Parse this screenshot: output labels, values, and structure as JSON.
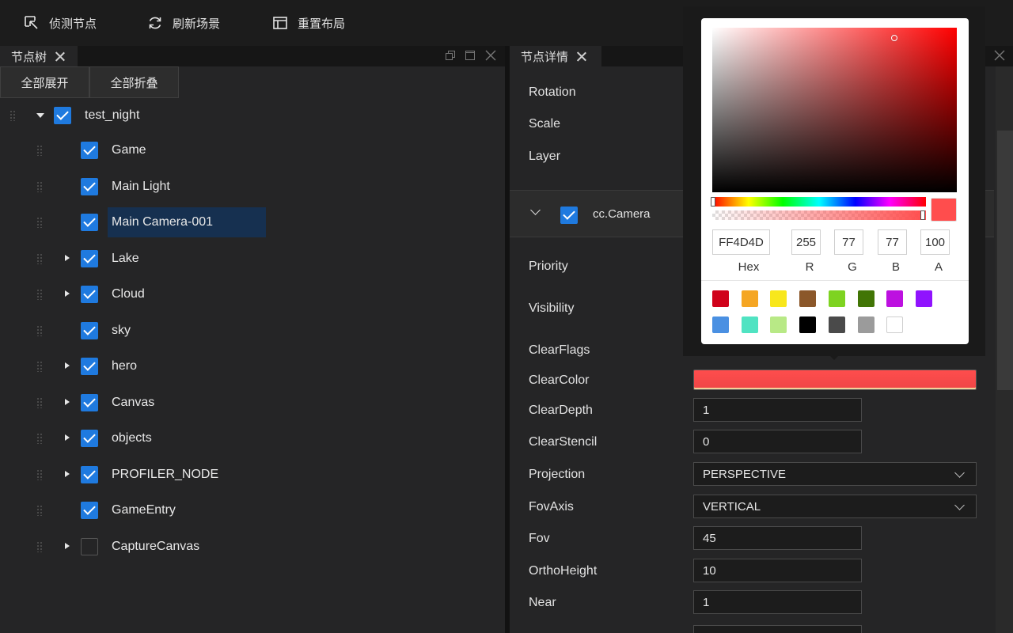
{
  "toolbar": {
    "detect_label": "侦测节点",
    "refresh_label": "刷新场景",
    "reset_label": "重置布局"
  },
  "left_panel": {
    "tab_title": "节点树",
    "expand_all": "全部展开",
    "collapse_all": "全部折叠",
    "tree": [
      {
        "label": "test_night",
        "checked": true,
        "expand": "open"
      },
      {
        "label": "Game",
        "checked": true,
        "expand": "none"
      },
      {
        "label": "Main Light",
        "checked": true,
        "expand": "none"
      },
      {
        "label": "Main Camera-001",
        "checked": true,
        "expand": "none",
        "selected": true
      },
      {
        "label": "Lake",
        "checked": true,
        "expand": "closed"
      },
      {
        "label": "Cloud",
        "checked": true,
        "expand": "closed"
      },
      {
        "label": "sky",
        "checked": true,
        "expand": "none"
      },
      {
        "label": "hero",
        "checked": true,
        "expand": "closed"
      },
      {
        "label": "Canvas",
        "checked": true,
        "expand": "closed"
      },
      {
        "label": "objects",
        "checked": true,
        "expand": "closed"
      },
      {
        "label": "PROFILER_NODE",
        "checked": true,
        "expand": "closed"
      },
      {
        "label": "GameEntry",
        "checked": true,
        "expand": "none"
      },
      {
        "label": "CaptureCanvas",
        "checked": false,
        "expand": "closed"
      }
    ]
  },
  "right_panel": {
    "tab_title": "节点详情",
    "node_props": {
      "rotation": "Rotation",
      "scale": "Scale",
      "layer": "Layer"
    },
    "component": {
      "name": "cc.Camera",
      "enabled": true
    },
    "props": {
      "priority": "Priority",
      "visibility": "Visibility",
      "clear_flags": "ClearFlags",
      "clear_color": "ClearColor",
      "clear_color_value": "#ff4d4d",
      "clear_depth": "ClearDepth",
      "clear_depth_value": "1",
      "clear_stencil": "ClearStencil",
      "clear_stencil_value": "0",
      "projection": "Projection",
      "projection_value": "PERSPECTIVE",
      "fov_axis": "FovAxis",
      "fov_axis_value": "VERTICAL",
      "fov": "Fov",
      "fov_value": "45",
      "ortho_height": "OrthoHeight",
      "ortho_height_value": "10",
      "near": "Near",
      "near_value": "1"
    }
  },
  "color_picker": {
    "hex": "FF4D4D",
    "r": "255",
    "g": "77",
    "b": "77",
    "a": "100",
    "hex_label": "Hex",
    "r_label": "R",
    "g_label": "G",
    "b_label": "B",
    "a_label": "A",
    "current_color": "#ff4d4d",
    "presets": [
      "#d0021b",
      "#f5a623",
      "#f8e71c",
      "#8b572a",
      "#7ed321",
      "#417505",
      "#bd10e0",
      "#9013fe",
      "#4a90e2",
      "#50e3c2",
      "#b8e986",
      "#000000",
      "#4a4a4a",
      "#9b9b9b",
      "#ffffff"
    ]
  }
}
